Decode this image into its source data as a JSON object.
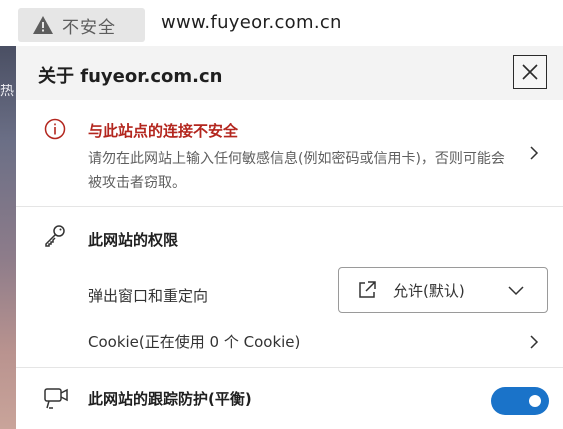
{
  "addressbar": {
    "security_label": "不安全",
    "url": "www.fuyeor.com.cn"
  },
  "background": {
    "glyph": "热"
  },
  "flyout": {
    "title": "关于 fuyeor.com.cn",
    "security": {
      "title": "与此站点的连接不安全",
      "description": "请勿在此网站上输入任何敏感信息(例如密码或信用卡)，否则可能会被攻击者窃取。",
      "title_color": "#b3261e"
    },
    "permissions": {
      "title": "此网站的权限",
      "popups_label": "弹出窗口和重定向",
      "popups_value": "允许(默认)",
      "cookie_label": "Cookie(正在使用 0 个 Cookie)"
    },
    "tracking": {
      "title": "此网站的跟踪防护(平衡)",
      "enabled": true,
      "toggle_color": "#1a73c9"
    }
  },
  "icons": {
    "warning": "warning-triangle-icon",
    "close": "close-icon",
    "info": "info-icon",
    "key": "key-icon",
    "external": "open-external-icon",
    "dropdown": "chevron-down-icon",
    "chevron": "chevron-right-icon",
    "tracking": "tracking-prevention-icon"
  }
}
